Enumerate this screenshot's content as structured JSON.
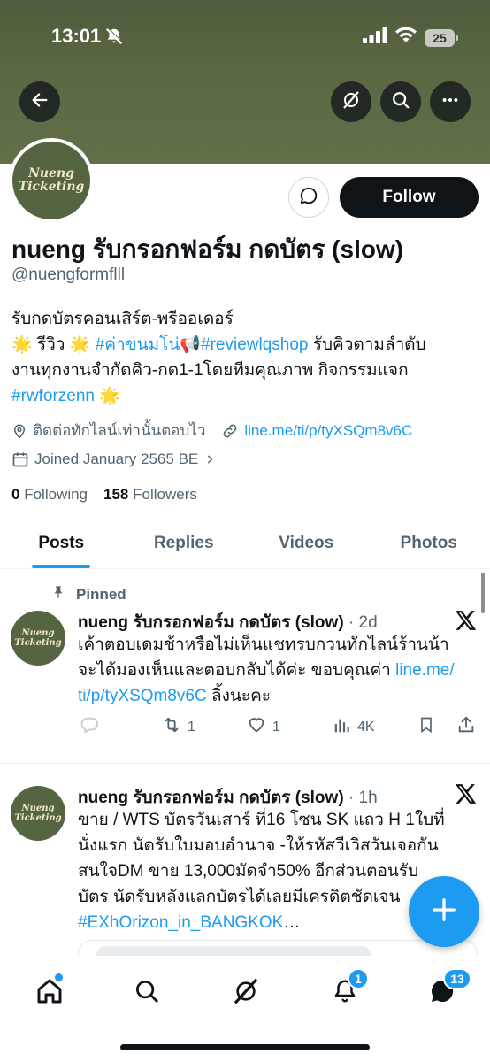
{
  "status_bar": {
    "time": "13:01",
    "battery": "25"
  },
  "profile": {
    "logo_line1": "Nueng",
    "logo_line2": "Ticketing",
    "display_name": "nueng รับกรอกฟอร์ม กดบัตร (slow)",
    "handle": "@nuengformflll",
    "follow_label": "Follow",
    "bio": {
      "line1": "รับกดบัตรคอนเสิร์ต-พรีออเดอร์",
      "line2_a": "🌟 รีวิว 🌟 ",
      "line2_tag1": "#ค่าขนมโน่",
      "line2_b": "📢",
      "line2_tag2": "#reviewlqshop",
      "line2_c": " รับคิวตามลำดับ",
      "line3": "งานทุกงานจำกัดคิว-กด1-1โดยทีมคุณภาพ กิจกรรมแจก",
      "line4_tag": "#rwforzenn",
      "line4_b": " 🌟"
    },
    "location": "ติดต่อทักไลน์เท่านั้นตอบไว",
    "website": "line.me/ti/p/tyXSQm8v6C",
    "joined": "Joined January 2565 BE",
    "following_count": "0",
    "following_label": "Following",
    "followers_count": "158",
    "followers_label": "Followers"
  },
  "tabs": [
    {
      "label": "Posts"
    },
    {
      "label": "Replies"
    },
    {
      "label": "Videos"
    },
    {
      "label": "Photos"
    }
  ],
  "tweets": [
    {
      "pinned_label": "Pinned",
      "name": "nueng รับกรอกฟอร์ม กดบัตร (slow)",
      "time": " · 2d",
      "line1": "เค้าตอบเดมช้าหรือไม่เห็นแชทรบกวนทักไลน์ร้านน้า",
      "line2_a": "จะได้มองเห็นและตอบกลับได้ค่ะ ขอบคุณค่า ",
      "line2_link": "line.me/",
      "line3_link": "ti/p/tyXSQm8v6C",
      "line3_b": " ลิ้งนะคะ",
      "retweets": "1",
      "likes": "1",
      "views": "4K"
    },
    {
      "name": "nueng รับกรอกฟอร์ม กดบัตร (slow)",
      "time": " · 1h",
      "line1": "ขาย / WTS บัตรวันเสาร์ ที่16 โซน SK แถว H 1ใบที่",
      "line2": "นั่งแรก   นัดรับใบมอบอำนาจ  -ให้รหัสวีเวิสวันเจอกัน",
      "line3": "สนใจDM ขาย 13,000มัดจำ50% อีกส่วนตอนรับ",
      "line4": "บัตร นัดรับหลังแลกบัตรได้เลยมีเครดิตชัดเจน",
      "line5_tag": "#EXhOrizon_in_BANGKOK",
      "line5_b": "…"
    }
  ],
  "nav": {
    "notifications_badge": "1",
    "messages_badge": "13"
  },
  "colors": {
    "accent": "#1d9bf0",
    "banner": "#5a6844",
    "text": "#0f1419",
    "muted": "#536471"
  }
}
